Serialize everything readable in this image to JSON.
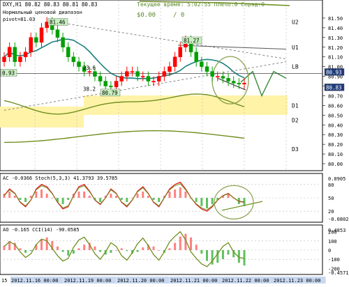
{
  "header": {
    "symbol_line": "DXY,H1  80.82 80.83 80.81 80.83",
    "info_line": "Текущее время: 5:02:55 Плечо:0 Спрэд:0",
    "range_label": "Нормальный ценовой диапазон",
    "pivot_label": "pivot=81.03",
    "profit_line": "$0.00",
    "lot_line": "/ 0"
  },
  "colors": {
    "background": "#ffffff",
    "candle_up": "#ff0000",
    "candle_down": "#00a000",
    "ma_teal": "#1a7f7f",
    "ma_olive": "#6f8f1f",
    "zone_yellow": "#fff3a8",
    "grid": "#b8b8b8",
    "axis": "#000000",
    "hist_pos": "#ff8080",
    "hist_neg": "#60c060",
    "arrow_circle": "#8ca050"
  },
  "chart_data": [
    {
      "type": "line",
      "title": "DXY,H1",
      "series": [
        {
          "name": "DXY",
          "kind": "candles",
          "close": [
            81.1,
            81.2,
            81.05,
            81.1,
            81.15,
            81.3,
            81.25,
            81.4,
            81.46,
            81.38,
            81.3,
            81.2,
            81.1,
            81.05,
            81.0,
            80.95,
            80.95,
            80.9,
            80.85,
            80.8,
            80.79,
            80.85,
            80.9,
            80.95,
            80.95,
            80.9,
            80.9,
            80.85,
            80.85,
            80.9,
            80.95,
            81.0,
            81.1,
            81.2,
            81.27,
            81.15,
            81.05,
            81.0,
            80.95,
            80.9,
            80.9,
            80.88,
            80.85,
            80.83,
            80.82,
            80.83
          ]
        }
      ],
      "price_levels": [
        {
          "label": "U2",
          "value": 81.46
        },
        {
          "label": "U1",
          "value": 81.2
        },
        {
          "label": "LB",
          "value": 81.0
        },
        {
          "label": "D1",
          "value": 80.6
        },
        {
          "label": "D2",
          "value": 80.45
        },
        {
          "label": "D3",
          "value": 80.15
        }
      ],
      "annotations": [
        {
          "text": "81.46",
          "kind": "price_flag"
        },
        {
          "text": "81.27",
          "kind": "price_flag"
        },
        {
          "text": "80.79",
          "kind": "price_flag"
        },
        {
          "text": "80.93",
          "kind": "current_price"
        },
        {
          "text": "80.83",
          "kind": "current_price"
        },
        {
          "text": "23.6",
          "kind": "fibonacci"
        },
        {
          "text": "38.2",
          "kind": "fibonacci"
        },
        {
          "text": "0.93",
          "kind": "level_tag"
        }
      ],
      "y_ticks": [
        "81.50",
        "81.40",
        "81.30",
        "81.20",
        "81.10",
        "81.00",
        "80.90",
        "80.80",
        "80.70",
        "80.60",
        "80.50",
        "80.40",
        "80.30",
        "80.20",
        "80.10",
        "80.00"
      ],
      "ylim": [
        79.95,
        81.6
      ],
      "grid": true
    },
    {
      "type": "line",
      "title": "AC -0.0366 Stoch(5,3,3) 41.3793 39.5785",
      "series": [
        {
          "name": "Stoch",
          "values": [
            55,
            70,
            60,
            40,
            30,
            45,
            70,
            80,
            75,
            60,
            40,
            25,
            30,
            55,
            75,
            80,
            65,
            45,
            35,
            50,
            70,
            60,
            40,
            30,
            45,
            65,
            75,
            60,
            40,
            30,
            50,
            70,
            80,
            85,
            70,
            50,
            35,
            25,
            20,
            30,
            45,
            55,
            60,
            50,
            42,
            40
          ]
        },
        {
          "name": "AC",
          "kind": "histogram",
          "values": [
            0.02,
            0.03,
            0.01,
            -0.01,
            -0.02,
            0.01,
            0.03,
            0.04,
            0.02,
            0.0,
            -0.02,
            -0.03,
            -0.01,
            0.02,
            0.03,
            0.03,
            0.01,
            -0.01,
            -0.02,
            0.01,
            0.02,
            0.01,
            -0.01,
            -0.02,
            0.0,
            0.02,
            0.03,
            0.01,
            -0.01,
            -0.02,
            0.01,
            0.03,
            0.04,
            0.05,
            0.03,
            0.0,
            -0.02,
            -0.04,
            -0.05,
            -0.03,
            -0.01,
            0.01,
            0.02,
            0.0,
            -0.03,
            -0.04
          ]
        }
      ],
      "y_ticks": [
        "0.0905",
        "80",
        "50",
        "20",
        "-0.0802"
      ],
      "levels": [
        80,
        50,
        20
      ],
      "ylim": [
        0,
        100
      ]
    },
    {
      "type": "line",
      "title": "AO -0.165 CCI(14) -90.0585",
      "series": [
        {
          "name": "CCI",
          "values": [
            40,
            90,
            60,
            -20,
            -80,
            -40,
            60,
            120,
            100,
            20,
            -60,
            -120,
            -90,
            30,
            110,
            140,
            60,
            -40,
            -100,
            -20,
            80,
            40,
            -60,
            -110,
            -30,
            70,
            130,
            50,
            -50,
            -110,
            -20,
            90,
            150,
            200,
            110,
            -20,
            -90,
            -150,
            -180,
            -120,
            -40,
            40,
            80,
            -20,
            -80,
            -90
          ]
        },
        {
          "name": "AO",
          "kind": "histogram",
          "values": [
            0.05,
            0.1,
            0.08,
            0.02,
            -0.03,
            -0.01,
            0.06,
            0.12,
            0.14,
            0.1,
            0.04,
            -0.02,
            -0.06,
            -0.04,
            0.02,
            0.06,
            0.08,
            0.04,
            -0.02,
            -0.05,
            -0.03,
            0.0,
            0.02,
            -0.01,
            -0.04,
            -0.02,
            0.03,
            0.06,
            0.04,
            0.0,
            -0.03,
            0.02,
            0.08,
            0.15,
            0.18,
            0.14,
            0.06,
            -0.04,
            -0.12,
            -0.16,
            -0.14,
            -0.1,
            -0.05,
            -0.08,
            -0.14,
            -0.17
          ]
        }
      ],
      "y_ticks": [
        "0.4853",
        "200",
        "100",
        "0",
        "-100",
        "-200",
        "-0.4571"
      ],
      "ylim": [
        -250,
        250
      ]
    }
  ],
  "time_axis": [
    "15",
    "2012.11.16 00:00",
    "2012.11.19 00:00",
    "2012.11.20 00:00",
    "2012.11.21 00:00",
    "2012.11.22 00:00",
    "2012.11.23 00:00"
  ]
}
